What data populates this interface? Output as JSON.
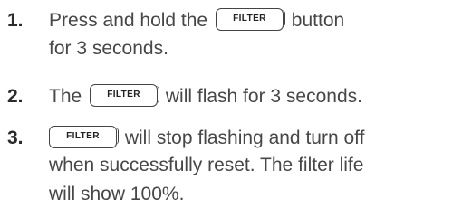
{
  "steps": [
    {
      "number": "1.",
      "line1_before": "Press and hold the ",
      "button": "FILTER",
      "line1_after": " button",
      "line2": "for 3 seconds."
    },
    {
      "number": "2.",
      "line1_before": "The ",
      "button": "FILTER",
      "line1_after": " will flash for 3 seconds."
    },
    {
      "number": "3.",
      "button": "FILTER",
      "line1_after": " will stop flashing and turn off",
      "line2": "when successfully reset. The filter life",
      "line3": "will show 100%."
    }
  ]
}
